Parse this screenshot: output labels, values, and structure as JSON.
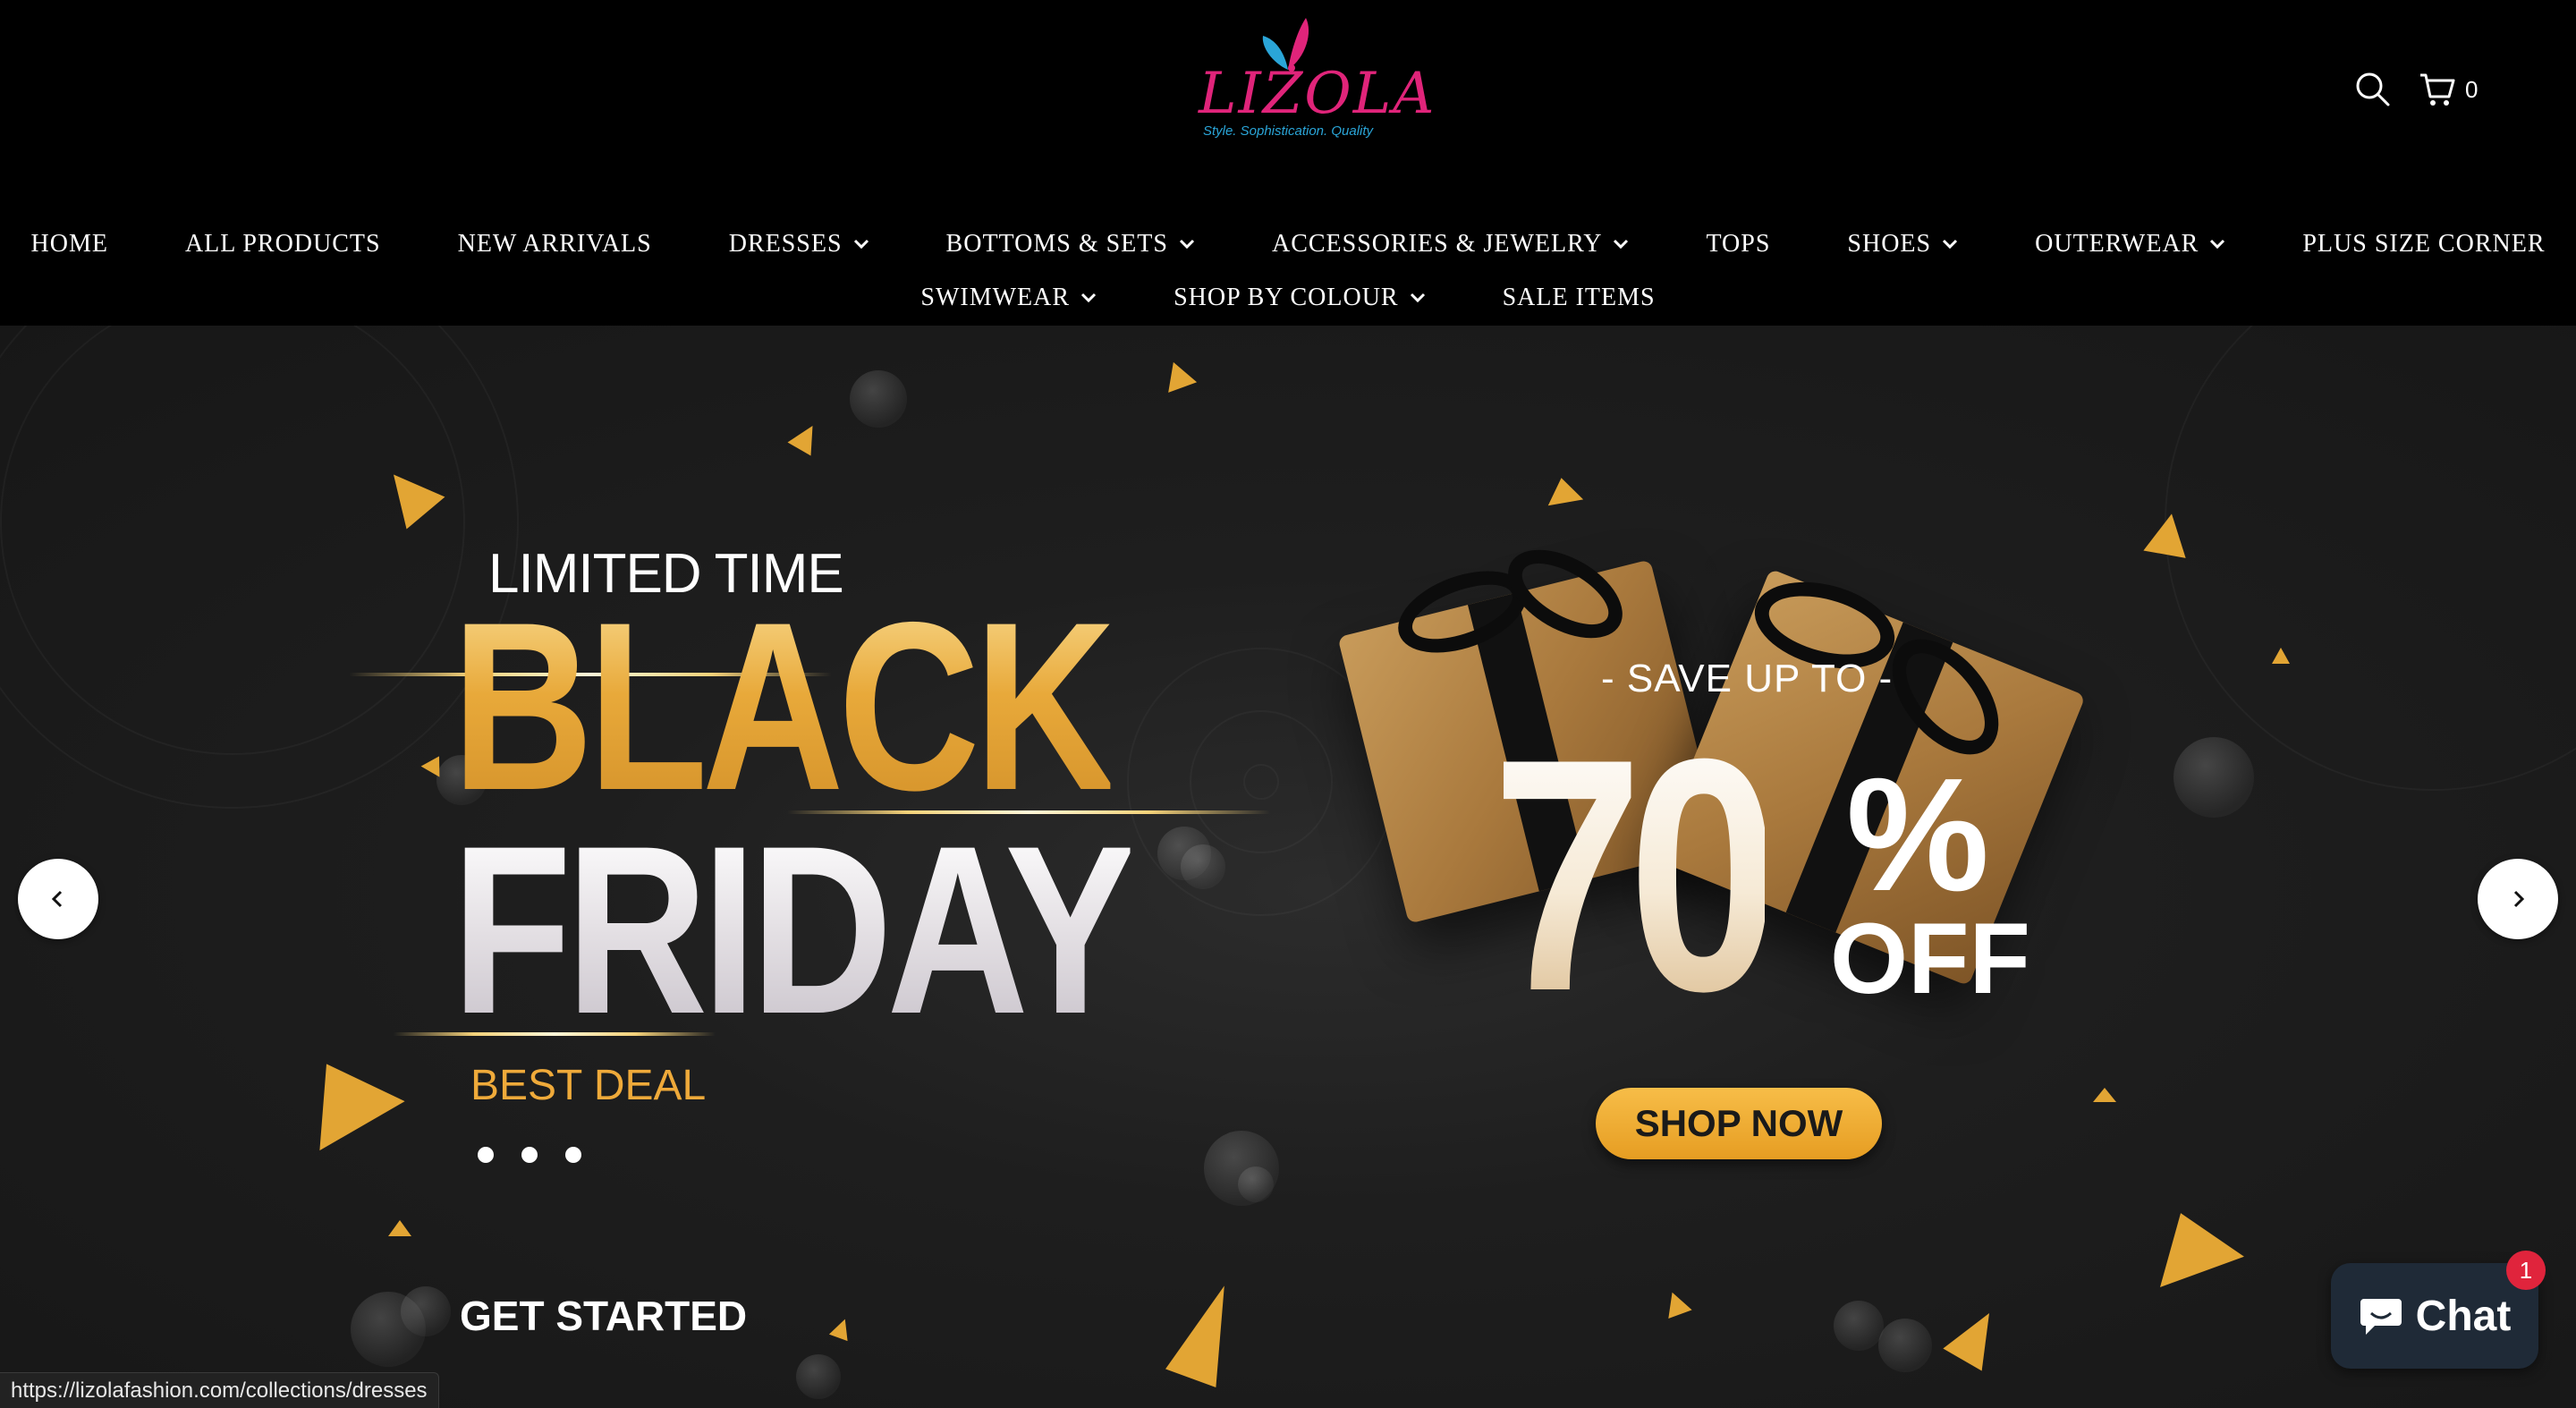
{
  "brand": {
    "logo_text": "LIZOLA",
    "tagline": "Style. Sophistication. Quality"
  },
  "header": {
    "cart_count": "0",
    "icons": [
      "search-icon",
      "cart-icon"
    ]
  },
  "nav": {
    "row1": [
      {
        "label": "HOME",
        "dropdown": false
      },
      {
        "label": "ALL PRODUCTS",
        "dropdown": false
      },
      {
        "label": "NEW ARRIVALS",
        "dropdown": false
      },
      {
        "label": "DRESSES",
        "dropdown": true
      },
      {
        "label": "BOTTOMS & SETS",
        "dropdown": true
      },
      {
        "label": "ACCESSORIES & JEWELRY",
        "dropdown": true
      },
      {
        "label": "TOPS",
        "dropdown": false
      },
      {
        "label": "SHOES",
        "dropdown": true
      },
      {
        "label": "OUTERWEAR",
        "dropdown": true
      },
      {
        "label": "PLUS SIZE CORNER",
        "dropdown": false
      }
    ],
    "row2": [
      {
        "label": "SWIMWEAR",
        "dropdown": true
      },
      {
        "label": "SHOP BY COLOUR",
        "dropdown": true
      },
      {
        "label": "SALE ITEMS",
        "dropdown": false
      }
    ]
  },
  "hero": {
    "limited": "LIMITED TIME",
    "black": "BLACK",
    "friday": "FRIDAY",
    "best_deal": "BEST DEAL",
    "save_up_to": "- SAVE UP TO -",
    "seventy": "70",
    "percent": "%",
    "off": "OFF",
    "shop_now": "SHOP NOW",
    "get_started": "GET STARTED",
    "slide_count": 3,
    "colors": {
      "gold": "#efaa3a",
      "button": "#f2b13b"
    }
  },
  "chat": {
    "label": "Chat",
    "badge": "1"
  },
  "status_bar": {
    "url": "https://lizolafashion.com/collections/dresses"
  }
}
